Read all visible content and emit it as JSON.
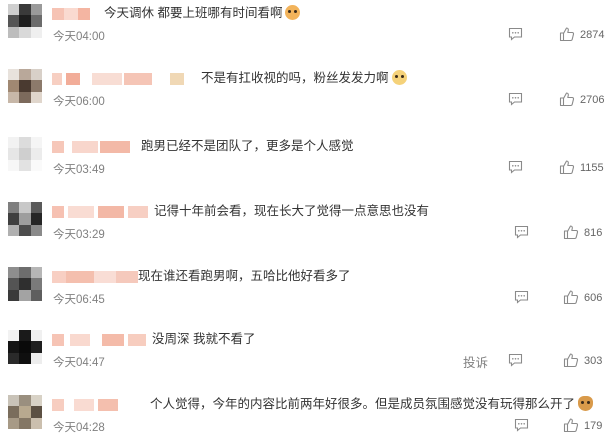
{
  "comments": [
    {
      "text": "今天调休 都要上班哪有时间看啊",
      "time": "今天04:00",
      "likes": "2874",
      "emoji": "dog-face",
      "report": ""
    },
    {
      "text": "不是有扛收视的吗，粉丝发发力啊",
      "time": "今天06:00",
      "likes": "2706",
      "emoji": "dog-face",
      "report": ""
    },
    {
      "text": "跑男已经不是团队了，更多是个人感觉",
      "time": "今天03:49",
      "likes": "1155",
      "emoji": "",
      "report": ""
    },
    {
      "text": "记得十年前会看，现在长大了觉得一点意思也没有",
      "time": "今天03:29",
      "likes": "816",
      "emoji": "",
      "report": ""
    },
    {
      "text": "现在谁还看跑男啊，五哈比他好看多了",
      "time": "今天06:45",
      "likes": "606",
      "emoji": "",
      "report": ""
    },
    {
      "text": "没周深 我就不看了",
      "time": "今天04:47",
      "likes": "303",
      "emoji": "",
      "report": "投诉"
    },
    {
      "text": "个人觉得，今年的内容比前两年好很多。但是成员氛围感觉没有玩得那么开了",
      "time": "今天04:28",
      "likes": "179",
      "emoji": "doge",
      "report": ""
    }
  ],
  "colors": {
    "text": "#333333",
    "meta": "#808080",
    "name_blur": "#f3b7a6",
    "icon": "#8a8a8a"
  }
}
